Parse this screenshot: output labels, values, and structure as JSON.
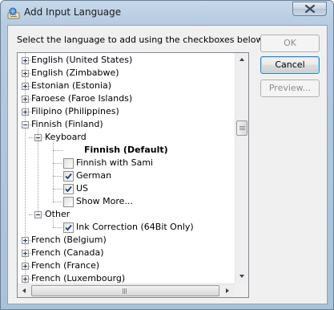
{
  "window": {
    "title": "Add Input Language",
    "close_icon": "close-x-icon",
    "title_icon": "keyboard-globe-icon"
  },
  "instruction": "Select the language to add using the checkboxes below.",
  "buttons": {
    "ok": {
      "label": "OK",
      "enabled": false
    },
    "cancel": {
      "label": "Cancel",
      "enabled": true
    },
    "preview": {
      "label": "Preview...",
      "enabled": false
    }
  },
  "tree": [
    {
      "label": "English (United States)",
      "level": 0,
      "type": "expandable",
      "expanded": false
    },
    {
      "label": "English (Zimbabwe)",
      "level": 0,
      "type": "expandable",
      "expanded": false
    },
    {
      "label": "Estonian (Estonia)",
      "level": 0,
      "type": "expandable",
      "expanded": false
    },
    {
      "label": "Faroese (Faroe Islands)",
      "level": 0,
      "type": "expandable",
      "expanded": false
    },
    {
      "label": "Filipino (Philippines)",
      "level": 0,
      "type": "expandable",
      "expanded": false
    },
    {
      "label": "Finnish (Finland)",
      "level": 0,
      "type": "expandable",
      "expanded": true
    },
    {
      "label": "Keyboard",
      "level": 1,
      "type": "expandable",
      "expanded": true
    },
    {
      "label": "Finnish (Default)",
      "level": 2,
      "type": "bold"
    },
    {
      "label": "Finnish with Sami",
      "level": 2,
      "type": "checkbox",
      "checked": false
    },
    {
      "label": "German",
      "level": 2,
      "type": "checkbox",
      "checked": true
    },
    {
      "label": "US",
      "level": 2,
      "type": "checkbox",
      "checked": true
    },
    {
      "label": "Show More...",
      "level": 2,
      "type": "checkbox",
      "checked": false
    },
    {
      "label": "Other",
      "level": 1,
      "type": "expandable",
      "expanded": true
    },
    {
      "label": "Ink Correction (64Bit Only)",
      "level": 2,
      "type": "checkbox",
      "checked": true
    },
    {
      "label": "French (Belgium)",
      "level": 0,
      "type": "expandable",
      "expanded": false
    },
    {
      "label": "French (Canada)",
      "level": 0,
      "type": "expandable",
      "expanded": false
    },
    {
      "label": "French (France)",
      "level": 0,
      "type": "expandable",
      "expanded": false
    },
    {
      "label": "French (Luxembourg)",
      "level": 0,
      "type": "expandable",
      "expanded": false
    }
  ],
  "scrollbars": {
    "vertical_thumb_icon": "scrollbar-thumb",
    "horizontal_thumb_icon": "scrollbar-thumb"
  }
}
